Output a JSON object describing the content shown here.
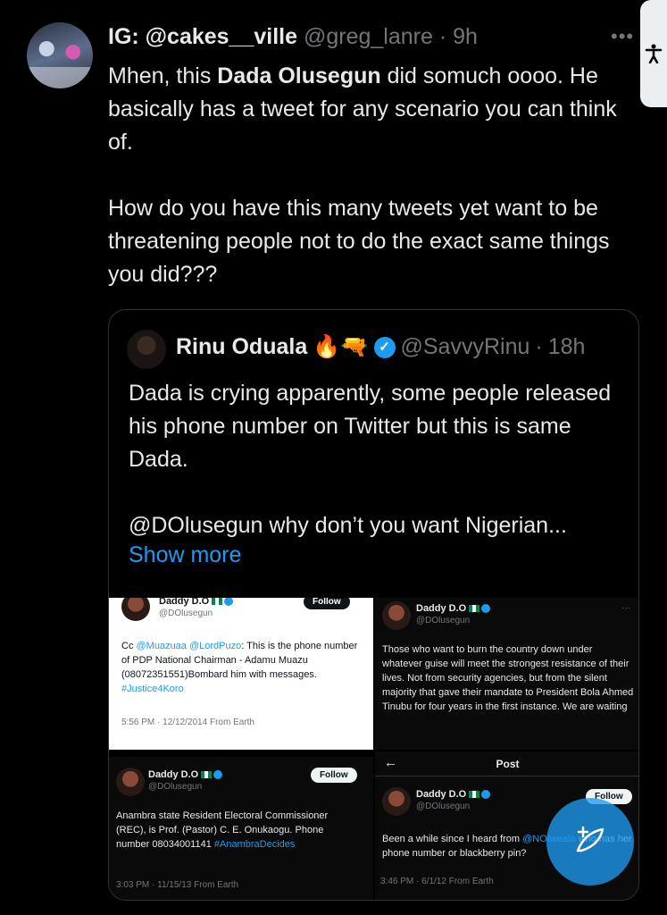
{
  "tweet": {
    "author_name": "IG: @cakes__ville",
    "handle": "@greg_lanre",
    "separator": "·",
    "time": "9h",
    "more_icon": "more-horizontal-icon",
    "text_line1_prefix": "Mhen, this ",
    "text_line1_bold": "Dada Olusegun",
    "text_line1_suffix": " did somuch oooo. He basically has a tweet for any scenario you can think of.",
    "text_para2": "How do you have this many tweets yet want to be threatening people not to do the exact same things you did???"
  },
  "quote": {
    "name": "Rinu Oduala",
    "emoji": "🔥🔫",
    "verified_icon": "verified-badge-icon",
    "handle": "@SavvyRinu",
    "separator": "·",
    "time": "18h",
    "text_para1": "Dada is crying apparently, some people released his phone number on Twitter but this is same Dada.",
    "text_para2": "@DOlusegun why don’t you want Nigerian...",
    "show_more": "Show more"
  },
  "screenshots": {
    "p1": {
      "name": "Daddy D.O",
      "handle": "@DOlusegun",
      "follow": "Follow",
      "text_cc": "Cc ",
      "mention1": "@Muazuaa",
      "mention2": "@LordPuzo",
      "text_body": ": This is the phone number of PDP National Chairman - Adamu Muazu (08072351551)Bombard him with messages. ",
      "hashtag": "#Justice4Koro",
      "meta": "5:56 PM · 12/12/2014 From Earth"
    },
    "p2": {
      "name": "Daddy D.O",
      "handle": "@DOlusegun",
      "dots": "···",
      "text": "Those who want to burn the country down under whatever guise will meet the strongest resistance of their lives. Not from security agencies, but from the silent majority that gave their mandate to President Bola Ahmed Tinubu for four years in the first instance. We are waiting"
    },
    "p3": {
      "name": "Daddy D.O",
      "handle": "@DOlusegun",
      "follow": "Follow",
      "text": "Anambra state Resident Electoral Commissioner (REC), is Prof. (Pastor) C. E. Onukaogu. Phone number 08034001141",
      "hashtag": "#AnambraDecides",
      "meta": "3:03 PM · 11/15/13 From Earth"
    },
    "p4": {
      "back_icon": "arrow-left-icon",
      "title": "Post",
      "name": "Daddy D.O",
      "handle": "@DOlusegun",
      "follow": "Follow",
      "text_prefix": "Been a while since I heard from ",
      "mention": "@NOIweala",
      "text_suffix": " who has her phone number or blackberry pin?",
      "meta": "3:46 PM · 6/1/12 From Earth"
    }
  },
  "fab_icon": "compose-post-icon",
  "accessibility_icon": "accessibility-icon",
  "colors": {
    "background": "#000000",
    "link": "#1d9bf0",
    "muted": "#71767b",
    "text": "#e7e9ea"
  }
}
